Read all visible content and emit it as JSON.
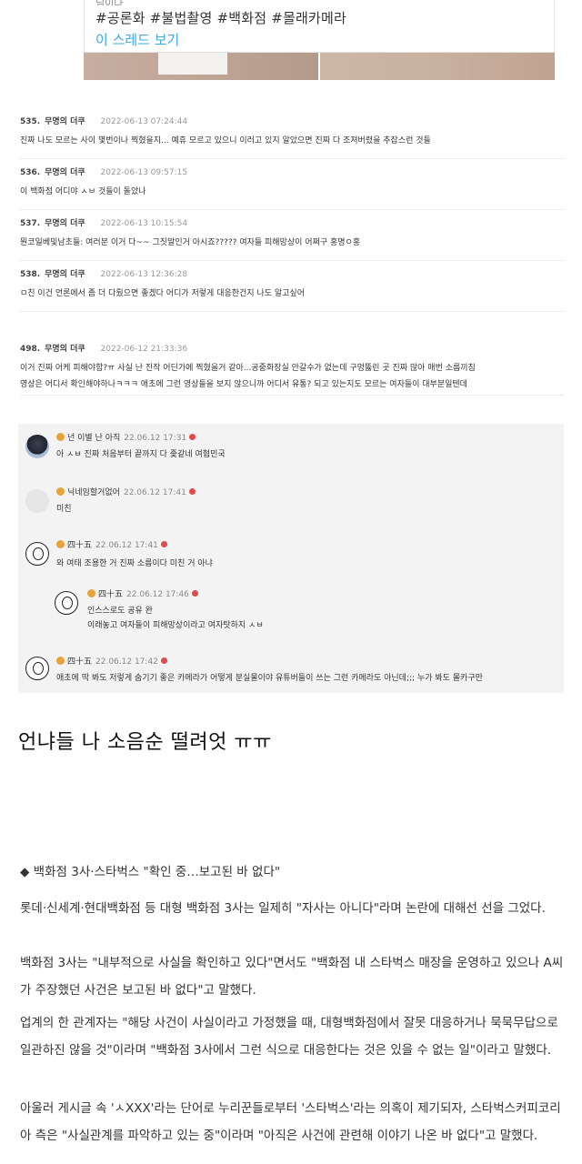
{
  "top_card": {
    "cut_text": "님이다",
    "tags": "#공론화 #불법촬영 #백화점 #몰래카메라",
    "link": "이 스레드 보기"
  },
  "thread": [
    {
      "num": "535.",
      "name": "무명의 더쿠",
      "date": "2022-06-13 07:24:44",
      "body": "진짜 나도 모르는 사이 몇번이나 찍혔을지... 예휴 모르고 있으니 이러고 있지 알았으면 진짜 다 조져버렸을 추잡스런 것들"
    },
    {
      "num": "536.",
      "name": "무명의 더쿠",
      "date": "2022-06-13 09:57:15",
      "body": "이 백화점 어디야 ㅅㅂ 것들이 돌았나"
    },
    {
      "num": "537.",
      "name": "무명의 더쿠",
      "date": "2022-06-13 10:15:54",
      "body": "뭔코일베및남초들: 여러분 이거 다~~ 그짓말인거 아시죠????? 여자들 피해망상이 어쩌구 홍명ㅇ홍"
    },
    {
      "num": "538.",
      "name": "무명의 더쿠",
      "date": "2022-06-13 12:36:28",
      "body": "ㅁ친 이건 언론에서 좀 더 다뤘으면 좋겠다 어디가 저렇게 대응한건지 나도 알고싶어"
    },
    {
      "num": "498.",
      "name": "무명의 더쿠",
      "date": "2022-06-12 21:33:36",
      "body": "이거 진짜 어케 피해야함?ㅠ 사실 난 진작 어딘가에 찍혔을거 같아...공중화장실 안갈수가 없는데 구멍뚫린 곳 진짜 많아 매번 소름끼침",
      "body2": "영상은 어디서 확인해야하나ㅋㅋㅋ 애초에 그런 영상들을 보지 않으니까 어디서 유통? 되고 있는지도 모르는 여자들이 대부분일텐데"
    }
  ],
  "replies": [
    {
      "nick": "넌 이별 난 아직",
      "date": "22.06.12 17:31",
      "text": "아 ㅅㅂ 진짜 처음부터 끝까지 다 좆같네 여혐민국"
    },
    {
      "nick": "닉네임할거없어",
      "date": "22.06.12 17:41",
      "text": "미친"
    },
    {
      "nick": "四十五",
      "date": "22.06.12 17:41",
      "text": "와 여태 조용한 거 진짜 소름이다 미친 거 아냐"
    },
    {
      "nick": "四十五",
      "date": "22.06.12 17:46",
      "text": "인스스로도 공유 완",
      "text2": "이래놓고 여자들이 피해망상이라고 여자탓하지 ㅅㅂ"
    },
    {
      "nick": "四十五",
      "date": "22.06.12 17:42",
      "text": "애초에 딱 봐도 저렇게 숨기기 좋은 카메라가 어떻게 분실물이야 유튜버들이 쓰는 그런 카메라도 아닌데;;; 누가 봐도 몰카구만"
    }
  ],
  "heading": "언냐들 나 소음순 떨려엇 ㅠㅠ",
  "article": {
    "subhead": "◆ 백화점 3사·스타벅스 \"확인 중…보고된 바 없다\"",
    "p1": "롯데·신세계·현대백화점 등 대형 백화점 3사는 일제히 \"자사는 아니다\"라며 논란에 대해선 선을 그었다.",
    "p2": "백화점 3사는 \"내부적으로 사실을 확인하고 있다\"면서도 \"백화점 내 스타벅스 매장을 운영하고 있으나 A씨가 주장했던 사건은 보고된 바 없다\"고 말했다.",
    "p3": "업계의 한 관계자는 \"해당 사건이 사실이라고 가정했을 때, 대형백화점에서 잘못 대응하거나 묵묵무답으로 일관하진 않을 것\"이라며 \"백화점 3사에서 그런 식으로 대응한다는 것은 있을 수 없는 일\"이라고 말했다.",
    "p4": "아울러 게시글 속 'ㅅXXX'라는 단어로 누리꾼들로부터 '스타벅스'라는 의혹이 제기되자, 스타벅스커피코리아 측은 \"사실관계를 파악하고 있는 중\"이라며 \"아직은 사건에 관련해 이야기 나온 바 없다\"고 말했다."
  }
}
